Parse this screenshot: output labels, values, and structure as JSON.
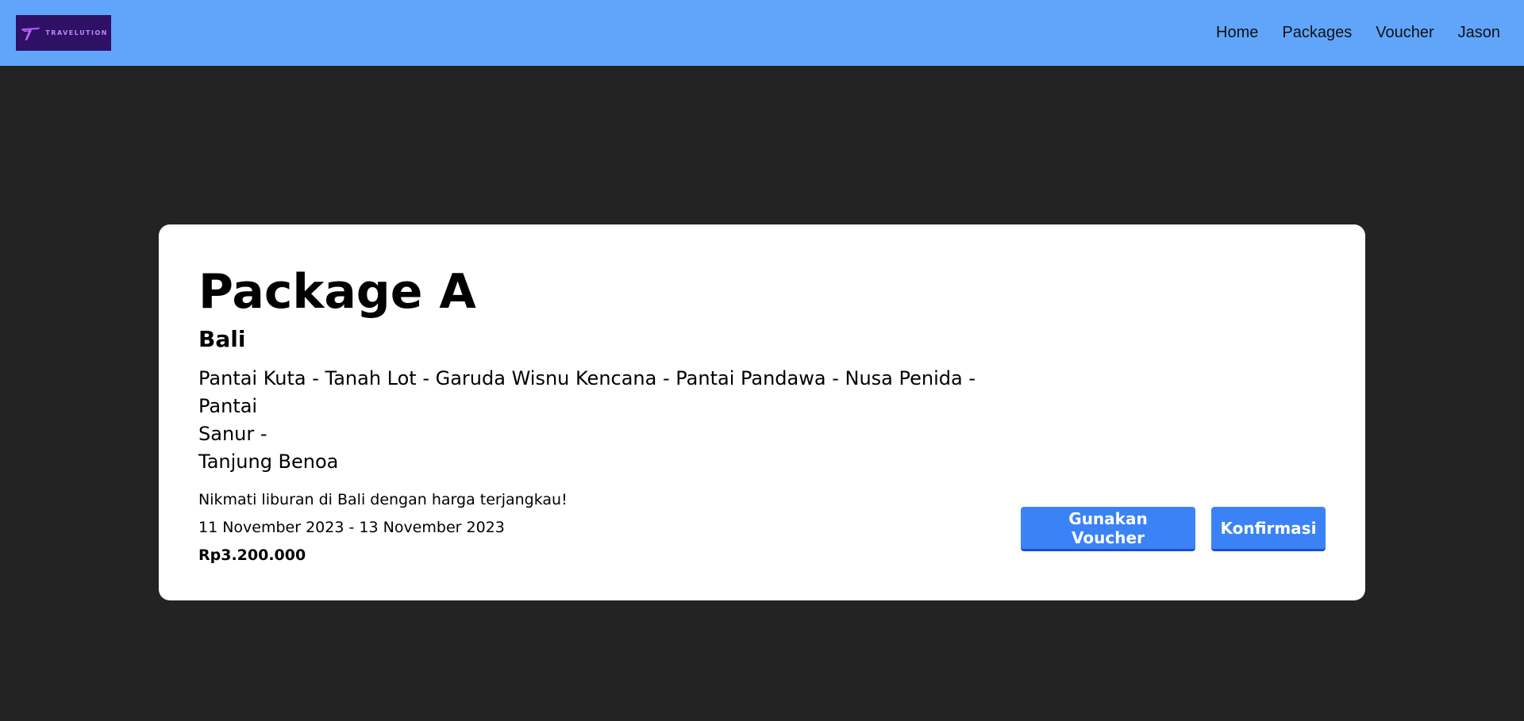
{
  "navbar": {
    "logo_text": "TRAVELUTION",
    "links": [
      "Home",
      "Packages",
      "Voucher",
      "Jason"
    ],
    "colors": {
      "background": "#60a5fa",
      "logo_bg": "#2e1065",
      "logo_accent": "#c084fc"
    }
  },
  "package": {
    "title": "Package A",
    "location": "Bali",
    "route_lines": [
      "Pantai Kuta - Tanah Lot - Garuda Wisnu Kencana - Pantai Pandawa - Nusa Penida - Pantai",
      "Sanur -",
      "Tanjung Benoa"
    ],
    "description": "Nikmati liburan di Bali dengan harga terjangkau!",
    "dates": "11 November 2023 - 13 November 2023",
    "price": "Rp3.200.000"
  },
  "actions": {
    "voucher_label": "Gunakan Voucher",
    "confirm_label": "Konfirmasi",
    "button_color": "#3b82f6"
  },
  "page": {
    "background": "#232323",
    "card_background": "#ffffff"
  }
}
